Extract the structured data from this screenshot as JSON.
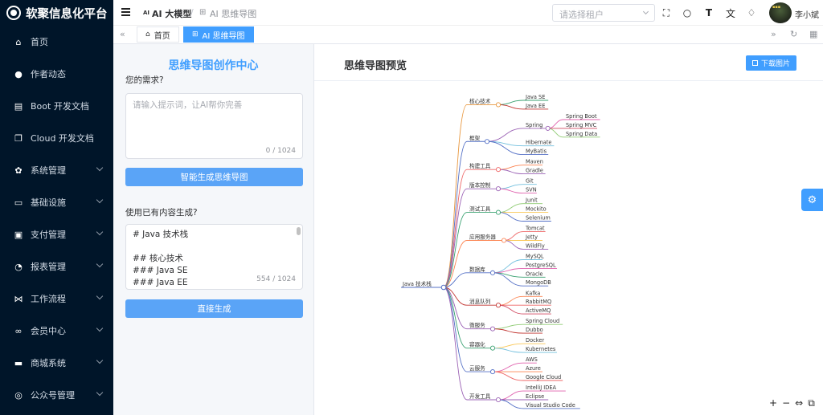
{
  "app": {
    "brand": "软聚信息化平台"
  },
  "sidebar": {
    "items": [
      {
        "label": "首页",
        "icon": "home-icon",
        "glyph": "⌂",
        "has_arrow": false
      },
      {
        "label": "作者动态",
        "icon": "user-icon",
        "glyph": "●",
        "has_arrow": false
      },
      {
        "label": "Boot 开发文档",
        "icon": "document-icon",
        "glyph": "▤",
        "has_arrow": false
      },
      {
        "label": "Cloud 开发文档",
        "icon": "document-copy-icon",
        "glyph": "❐",
        "has_arrow": false
      },
      {
        "label": "系统管理",
        "icon": "gear-icon",
        "glyph": "✿",
        "has_arrow": true
      },
      {
        "label": "基础设施",
        "icon": "monitor-icon",
        "glyph": "▭",
        "has_arrow": true
      },
      {
        "label": "支付管理",
        "icon": "wallet-icon",
        "glyph": "▣",
        "has_arrow": true
      },
      {
        "label": "报表管理",
        "icon": "pie-chart-icon",
        "glyph": "◔",
        "has_arrow": true
      },
      {
        "label": "工作流程",
        "icon": "workflow-icon",
        "glyph": "⋈",
        "has_arrow": true
      },
      {
        "label": "会员中心",
        "icon": "members-icon",
        "glyph": "∞",
        "has_arrow": true
      },
      {
        "label": "商城系统",
        "icon": "shop-icon",
        "glyph": "▬",
        "has_arrow": true
      },
      {
        "label": "公众号管理",
        "icon": "compass-icon",
        "glyph": "◎",
        "has_arrow": true
      }
    ]
  },
  "header": {
    "breadcrumb_ai_icon": "AI",
    "breadcrumb_1": "AI 大模型",
    "breadcrumb_sep": "/",
    "breadcrumb_2": "AI 思维导图",
    "tenant_placeholder": "请选择租户",
    "icons": [
      "fullscreen-icon",
      "search-icon",
      "font-size-icon",
      "translate-icon",
      "bell-icon"
    ],
    "username": "李小斌"
  },
  "tags": {
    "home": "首页",
    "current": "AI 思维导图"
  },
  "left": {
    "title": "思维导图创作中心",
    "need_label": "您的需求?",
    "prompt_placeholder": "请输入提示词，让AI帮你完善",
    "prompt_count": "0 / 1024",
    "generate_btn": "智能生成思维导图",
    "existing_label": "使用已有内容生成?",
    "existing_lines": [
      "# Java 技术栈",
      "",
      "## 核心技术",
      "### Java SE",
      "### Java EE"
    ],
    "existing_count": "554 / 1024",
    "direct_btn": "直接生成"
  },
  "preview": {
    "title": "思维导图预览",
    "download_btn": "下载图片",
    "zoom_tools": [
      "+",
      "−",
      "⇔",
      "⧉"
    ]
  },
  "mindmap": {
    "root": "Java 技术栈",
    "branches": [
      {
        "label": "核心技术",
        "color": "#e8973e",
        "children": [
          {
            "label": "Java SE",
            "color": "#3ba272"
          },
          {
            "label": "Java EE",
            "color": "#c23531"
          }
        ]
      },
      {
        "label": "框架",
        "color": "#5470c6",
        "children": [
          {
            "label": "Spring",
            "color": "#9a60b4",
            "children": [
              {
                "label": "Spring Boot",
                "color": "#e062ae"
              },
              {
                "label": "Spring MVC",
                "color": "#d14a61"
              },
              {
                "label": "Spring Data",
                "color": "#91cc75"
              }
            ]
          },
          {
            "label": "Hibernate",
            "color": "#73c0de"
          },
          {
            "label": "MyBatis",
            "color": "#5470c6"
          }
        ]
      },
      {
        "label": "构建工具",
        "color": "#ee6666",
        "children": [
          {
            "label": "Maven",
            "color": "#fc8452"
          },
          {
            "label": "Gradle",
            "color": "#9a60b4"
          }
        ]
      },
      {
        "label": "版本控制",
        "color": "#9a60b4",
        "children": [
          {
            "label": "Git",
            "color": "#73c0de"
          },
          {
            "label": "SVN",
            "color": "#e062ae"
          }
        ]
      },
      {
        "label": "测试工具",
        "color": "#3ba272",
        "children": [
          {
            "label": "Junit",
            "color": "#91cc75"
          },
          {
            "label": "Mockito",
            "color": "#fac858"
          },
          {
            "label": "Selenium",
            "color": "#5470c6"
          }
        ]
      },
      {
        "label": "应用服务器",
        "color": "#fc8452",
        "children": [
          {
            "label": "Tomcat",
            "color": "#ee6666"
          },
          {
            "label": "Jetty",
            "color": "#fac858"
          },
          {
            "label": "WildFly",
            "color": "#9a60b4"
          }
        ]
      },
      {
        "label": "数据库",
        "color": "#5470c6",
        "children": [
          {
            "label": "MySQL",
            "color": "#73c0de"
          },
          {
            "label": "PostgreSQL",
            "color": "#e062ae"
          },
          {
            "label": "Oracle",
            "color": "#3ba272"
          },
          {
            "label": "MongoDB",
            "color": "#5470c6"
          }
        ]
      },
      {
        "label": "消息队列",
        "color": "#c23531",
        "children": [
          {
            "label": "Kafka",
            "color": "#fc8452"
          },
          {
            "label": "RabbitMQ",
            "color": "#ee6666"
          },
          {
            "label": "ActiveMQ",
            "color": "#d14a61"
          }
        ]
      },
      {
        "label": "微服务",
        "color": "#9a60b4",
        "children": [
          {
            "label": "Spring Cloud",
            "color": "#91cc75"
          },
          {
            "label": "Dubbo",
            "color": "#c23531"
          }
        ]
      },
      {
        "label": "容器化",
        "color": "#3ba272",
        "children": [
          {
            "label": "Docker",
            "color": "#fac858"
          },
          {
            "label": "Kubernetes",
            "color": "#73c0de"
          }
        ]
      },
      {
        "label": "云服务",
        "color": "#5470c6",
        "children": [
          {
            "label": "AWS",
            "color": "#e062ae"
          },
          {
            "label": "Azure",
            "color": "#fc8452"
          },
          {
            "label": "Google Cloud",
            "color": "#ee6666"
          }
        ]
      },
      {
        "label": "开发工具",
        "color": "#9a60b4",
        "children": [
          {
            "label": "IntelliJ IDEA",
            "color": "#e062ae"
          },
          {
            "label": "Eclipse",
            "color": "#9a60b4"
          },
          {
            "label": "Visual Studio Code",
            "color": "#5470c6"
          }
        ]
      }
    ]
  }
}
